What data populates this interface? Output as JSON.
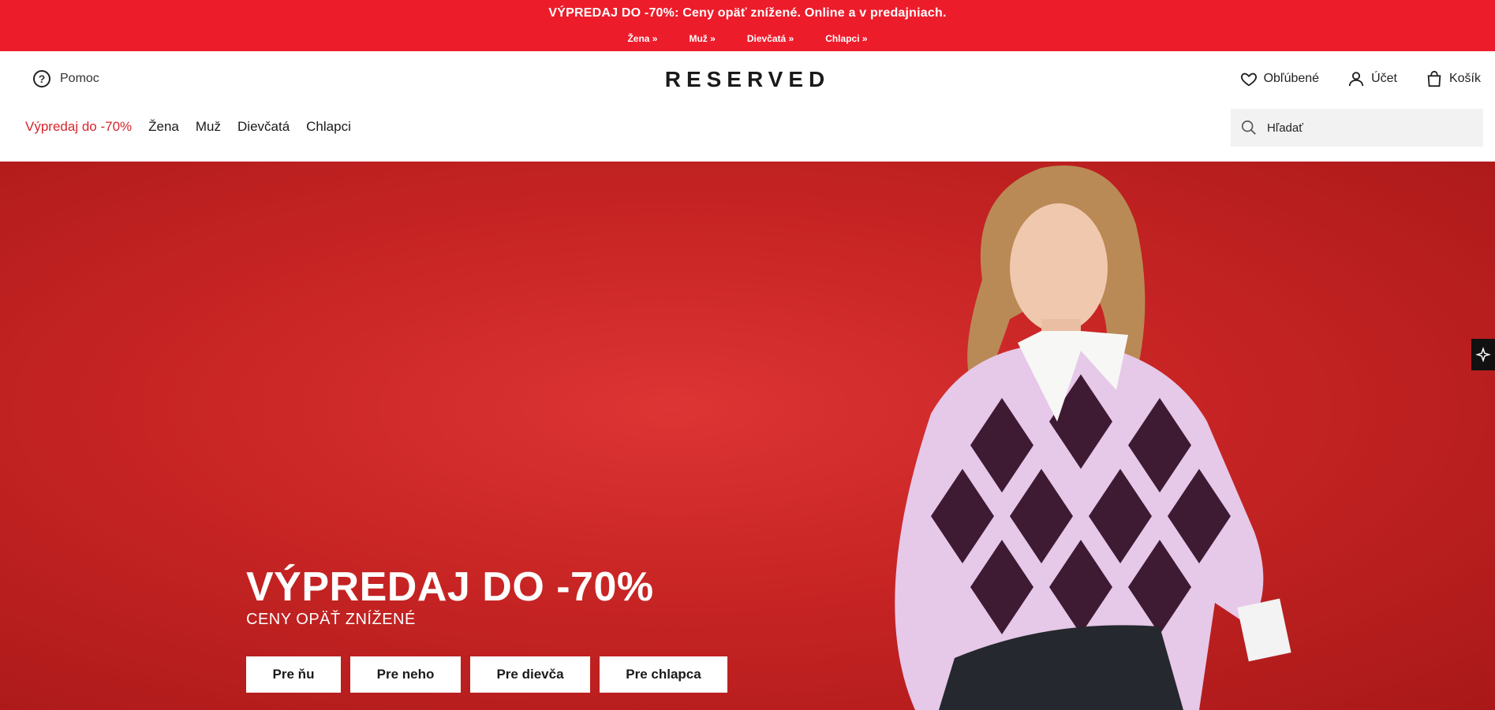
{
  "promo": {
    "message": "VÝPREDAJ DO -70%: Ceny opäť znížené. Online a v predajniach.",
    "links": [
      "Žena »",
      "Muž »",
      "Dievčatá »",
      "Chlapci »"
    ]
  },
  "header": {
    "help_label": "Pomoc",
    "logo": "RESERVED",
    "favorites_label": "Obľúbené",
    "account_label": "Účet",
    "cart_label": "Košík"
  },
  "nav": {
    "sale": "Výpredaj do -70%",
    "items": [
      "Žena",
      "Muž",
      "Dievčatá",
      "Chlapci"
    ]
  },
  "search": {
    "placeholder": "Hľadať"
  },
  "hero": {
    "title": "VÝPREDAJ DO -70%",
    "subtitle": "CENY OPÄŤ ZNÍŽENÉ",
    "buttons": [
      "Pre ňu",
      "Pre neho",
      "Pre dievča",
      "Pre chlapca"
    ]
  },
  "colors": {
    "promo_bg": "#ed1c2b",
    "sale_link": "#d8242c",
    "hero_bg": "#c72424"
  }
}
